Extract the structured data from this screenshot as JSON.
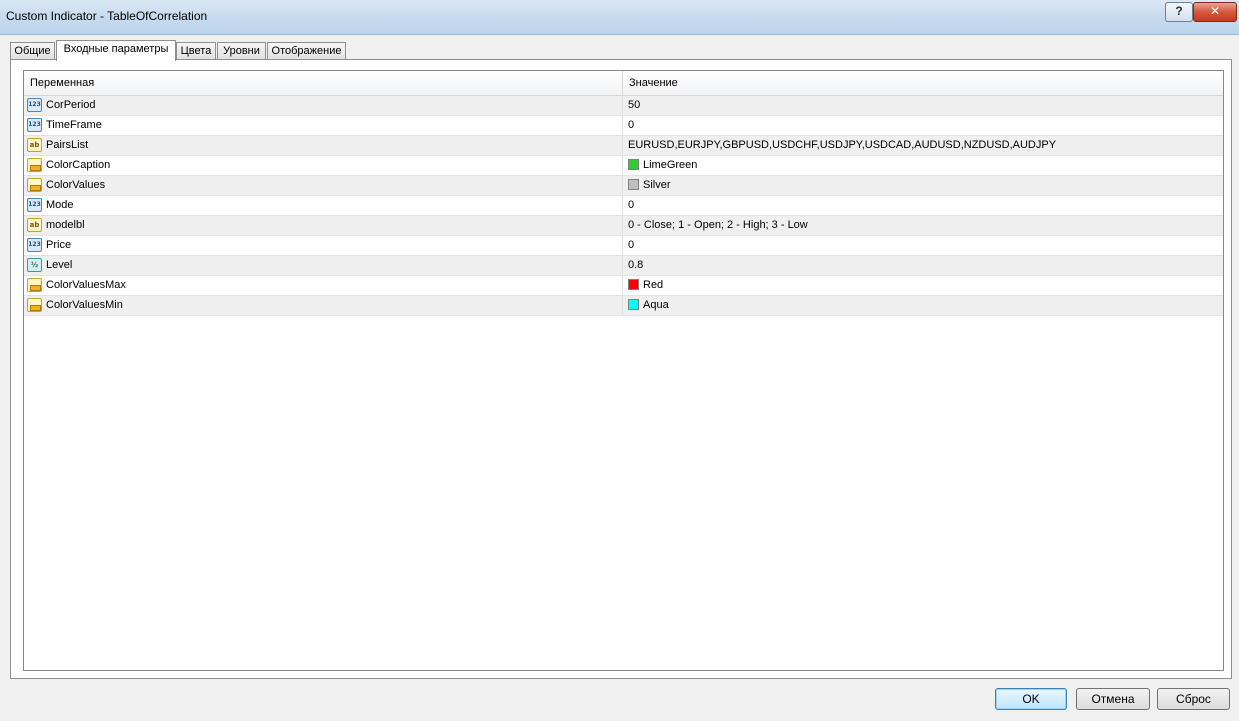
{
  "window": {
    "title": "Custom Indicator - TableOfCorrelation",
    "help_label": "?",
    "close_label": "✕"
  },
  "tabs": [
    {
      "label": "Общие"
    },
    {
      "label": "Входные параметры"
    },
    {
      "label": "Цвета"
    },
    {
      "label": "Уровни"
    },
    {
      "label": "Отображение"
    }
  ],
  "table": {
    "headers": {
      "variable": "Переменная",
      "value": "Значение"
    },
    "rows": [
      {
        "name": "CorPeriod",
        "value": "50",
        "icon": "int-icon"
      },
      {
        "name": "TimeFrame",
        "value": "0",
        "icon": "int-icon"
      },
      {
        "name": "PairsList",
        "value": "EURUSD,EURJPY,GBPUSD,USDCHF,USDJPY,USDCAD,AUDUSD,NZDUSD,AUDJPY",
        "icon": "string-icon"
      },
      {
        "name": "ColorCaption",
        "value": "LimeGreen",
        "icon": "color-icon",
        "color": "#32cd32"
      },
      {
        "name": "ColorValues",
        "value": "Silver",
        "icon": "color-icon",
        "color": "#c0c0c0"
      },
      {
        "name": "Mode",
        "value": "0",
        "icon": "int-icon"
      },
      {
        "name": "modelbl",
        "value": "0 - Close; 1 - Open; 2 - High; 3 - Low",
        "icon": "string-icon"
      },
      {
        "name": "Price",
        "value": "0",
        "icon": "int-icon"
      },
      {
        "name": "Level",
        "value": "0.8",
        "icon": "double-icon"
      },
      {
        "name": "ColorValuesMax",
        "value": "Red",
        "icon": "color-icon",
        "color": "#ff0000"
      },
      {
        "name": "ColorValuesMin",
        "value": "Aqua",
        "icon": "color-icon",
        "color": "#00ffff"
      }
    ]
  },
  "icon_glyphs": {
    "int": "123",
    "string": "ab",
    "double": "½"
  },
  "buttons": {
    "ok": "OK",
    "cancel": "Отмена",
    "reset": "Сброс"
  }
}
